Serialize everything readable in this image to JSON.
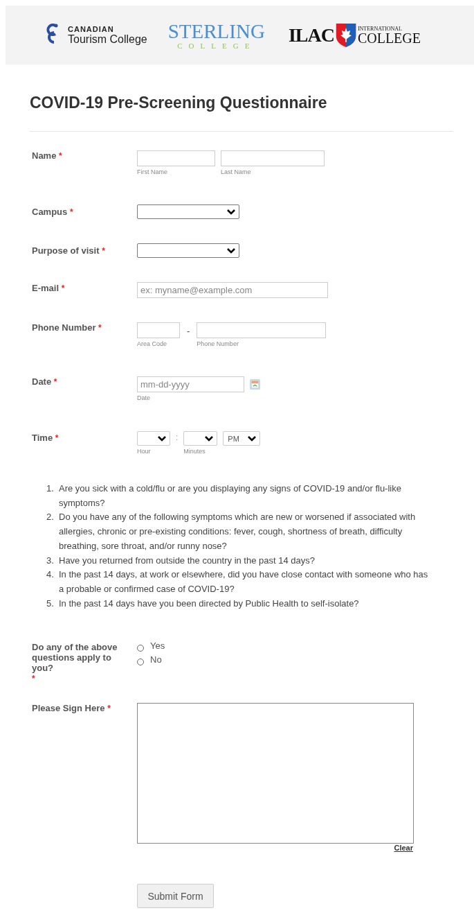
{
  "header": {
    "logos": [
      {
        "kind": "ctc",
        "lines": [
          "CANADIAN",
          "Tourism College"
        ]
      },
      {
        "kind": "sterling",
        "lines": [
          "STERLING",
          "COLLEGE"
        ]
      },
      {
        "kind": "ilac",
        "lines": [
          "ILAC",
          "INTERNATIONAL",
          "COLLEGE"
        ]
      }
    ]
  },
  "title": "COVID-19 Pre-Screening Questionnaire",
  "required_mark": "*",
  "fields": [
    {
      "kind": "name",
      "label": "Name",
      "required": true,
      "sublabels": [
        "First Name",
        "Last Name"
      ]
    },
    {
      "kind": "select",
      "label": "Campus",
      "required": true
    },
    {
      "kind": "select",
      "label": "Purpose of visit",
      "required": true
    },
    {
      "kind": "email",
      "label": "E-mail",
      "required": true,
      "placeholder": "ex: myname@example.com"
    },
    {
      "kind": "phone",
      "label": "Phone Number",
      "required": true,
      "separator": "-",
      "sublabels": [
        "Area Code",
        "Phone Number"
      ]
    },
    {
      "kind": "date",
      "label": "Date",
      "required": true,
      "placeholder": "mm-dd-yyyy",
      "sublabels": [
        "Date"
      ]
    },
    {
      "kind": "time",
      "label": "Time",
      "required": true,
      "separator": ":",
      "ampm": "PM",
      "sublabels": [
        "Hour",
        "Minutes"
      ]
    }
  ],
  "questions": [
    {
      "number": "1.",
      "text": "Are you sick with a cold/flu or are you displaying any signs of COVID-19 and/or flu-like symptoms?"
    },
    {
      "number": "2.",
      "text": "Do you have any of the following symptoms which are new or worsened if associated with allergies, chronic or pre-existing conditions: fever, cough, shortness of breath, difficulty breathing, sore throat, and/or runny nose?"
    },
    {
      "number": "3.",
      "text": "Have you returned from outside the country in the past 14 days?"
    },
    {
      "number": "4.",
      "text": "In the past 14 days, at work or elsewhere, did you have close contact with someone who has a probable or confirmed case of COVID-19?"
    },
    {
      "number": "5.",
      "text": "In the past 14 days have you been directed by Public Health to self-isolate?"
    }
  ],
  "radio": {
    "label": "Do any of the above questions apply to you?",
    "required": true,
    "options": [
      {
        "label": "Yes",
        "selected": false
      },
      {
        "label": "No",
        "selected": false
      }
    ]
  },
  "signature": {
    "label": "Please Sign Here",
    "required": true,
    "clear": "Clear"
  },
  "submit": "Submit Form"
}
